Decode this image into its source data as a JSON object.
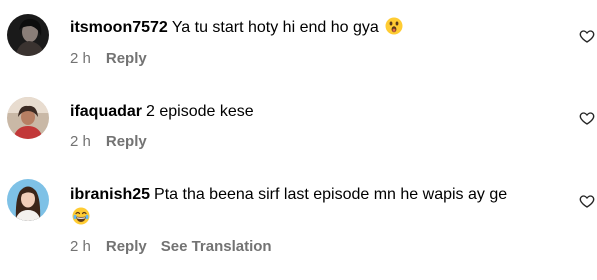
{
  "comments": [
    {
      "username": "itsmoon7572",
      "text": "Ya tu start hoty hi end ho gya",
      "emoji": "astonished-face",
      "time": "2 h",
      "reply_label": "Reply"
    },
    {
      "username": "ifaquadar",
      "text": "2 episode kese",
      "time": "2 h",
      "reply_label": "Reply"
    },
    {
      "username": "ibranish25",
      "text": "Pta tha beena sirf last episode mn he wapis ay ge",
      "emoji": "laughing-face",
      "time": "2 h",
      "reply_label": "Reply",
      "translation_label": "See Translation"
    }
  ],
  "colors": {
    "text": "#000000",
    "meta": "#737373",
    "background": "#ffffff"
  },
  "icons": [
    "avatar",
    "astonished-face",
    "laughing-face",
    "heart-outline-icon"
  ]
}
